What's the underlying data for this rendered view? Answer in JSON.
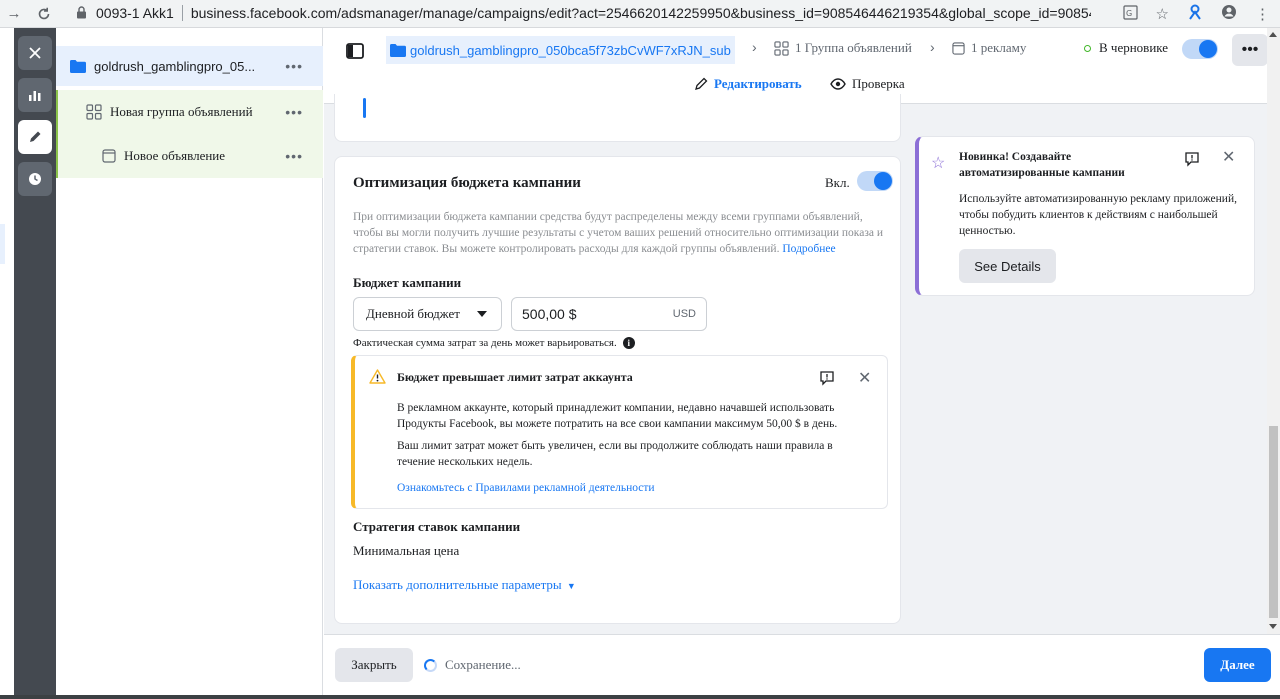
{
  "browser": {
    "tab_label": "0093-1 Akk1",
    "url": "business.facebook.com/adsmanager/manage/campaigns/edit?act=2546620142259950&business_id=908546446219354&global_scope_id=90854644..."
  },
  "tree": {
    "campaign": "goldrush_gamblingpro_05...",
    "adset": "Новая группа объявлений",
    "ad": "Новое объявление",
    "more": "•••"
  },
  "topbar": {
    "campaign_crumb": "goldrush_gamblingpro_050bca5f73zbCvWF7xRJN_sub",
    "adset_crumb": "1 Группа объявлений",
    "ad_crumb": "1 рекламу",
    "status": "В черновике",
    "more": "•••",
    "tab_edit": "Редактировать",
    "tab_review": "Проверка"
  },
  "budget": {
    "title": "Оптимизация бюджета кампании",
    "toggle_label": "Вкл.",
    "description": "При оптимизации бюджета кампании средства будут распределены между всеми группами объявлений, чтобы вы могли получить лучшие результаты с учетом ваших решений относительно оптимизации показа и стратегии ставок. Вы можете контролировать расходы для каждой группы объявлений.",
    "learn_more": "Подробнее",
    "budget_label": "Бюджет кампании",
    "budget_type": "Дневной бюджет",
    "amount": "500,00 $",
    "currency": "USD",
    "varies_note": "Фактическая сумма затрат за день может варьироваться.",
    "strategy_label": "Стратегия ставок кампании",
    "strategy_value": "Минимальная цена",
    "more_params": "Показать дополнительные параметры"
  },
  "warning": {
    "title": "Бюджет превышает лимит затрат аккаунта",
    "p1": "В рекламном аккаунте, который принадлежит компании, недавно начавшей использовать Продукты Facebook, вы можете потратить на все свои кампании максимум 50,00 $ в день.",
    "p2": "Ваш лимит затрат может быть увеличен, если вы продолжите соблюдать наши правила в течение нескольких недель.",
    "link": "Ознакомьтесь с Правилами рекламной деятельности"
  },
  "tip": {
    "title": "Новинка! Создавайте автоматизированные кампании",
    "text": "Используйте автоматизированную рекламу приложений, чтобы побудить клиентов к действиям с наибольшей ценностью.",
    "button": "See Details"
  },
  "footer": {
    "close": "Закрыть",
    "saving": "Сохранение...",
    "next": "Далее"
  },
  "colors": {
    "accent": "#1877f2",
    "warning": "#f7b928",
    "tip": "#8c6fd6",
    "rail": "#444950"
  }
}
